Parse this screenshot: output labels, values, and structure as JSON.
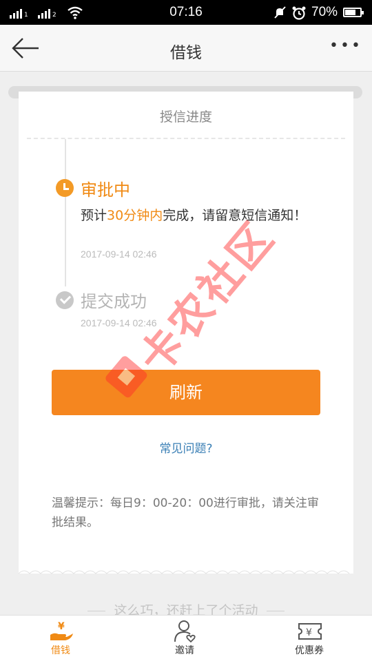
{
  "status_bar": {
    "time": "07:16",
    "battery": "70%",
    "signal1_label": "1",
    "signal2_label": "2"
  },
  "nav": {
    "title": "借钱",
    "back_icon": "back-arrow-icon",
    "more_label": "•••"
  },
  "progress": {
    "heading": "授信进度",
    "steps": [
      {
        "label": "审批中",
        "desc_prefix": "预计",
        "desc_highlight": "30分钟内",
        "desc_suffix": "完成，请留意短信通知！",
        "time": "2017-09-14 02:46",
        "icon": "clock-icon"
      },
      {
        "label": "提交成功",
        "time": "2017-09-14 02:46",
        "icon": "check-icon"
      }
    ]
  },
  "actions": {
    "refresh_label": "刷新",
    "faq_label": "常见问题?"
  },
  "tip": "温馨提示：每日9：00-20：00进行审批，请关注审批结果。",
  "watermark_text": "卡农社区",
  "promo_text": "这么巧，还赶上了个活动",
  "tabs": [
    {
      "label": "借钱",
      "icon": "hand-yuan-icon",
      "active": true
    },
    {
      "label": "邀请",
      "icon": "user-heart-icon",
      "active": false
    },
    {
      "label": "优惠券",
      "icon": "coupon-yuan-icon",
      "active": false
    }
  ],
  "colors": {
    "accent": "#f5861f",
    "highlight_text": "#f08a14",
    "link": "#3a7fb5"
  }
}
